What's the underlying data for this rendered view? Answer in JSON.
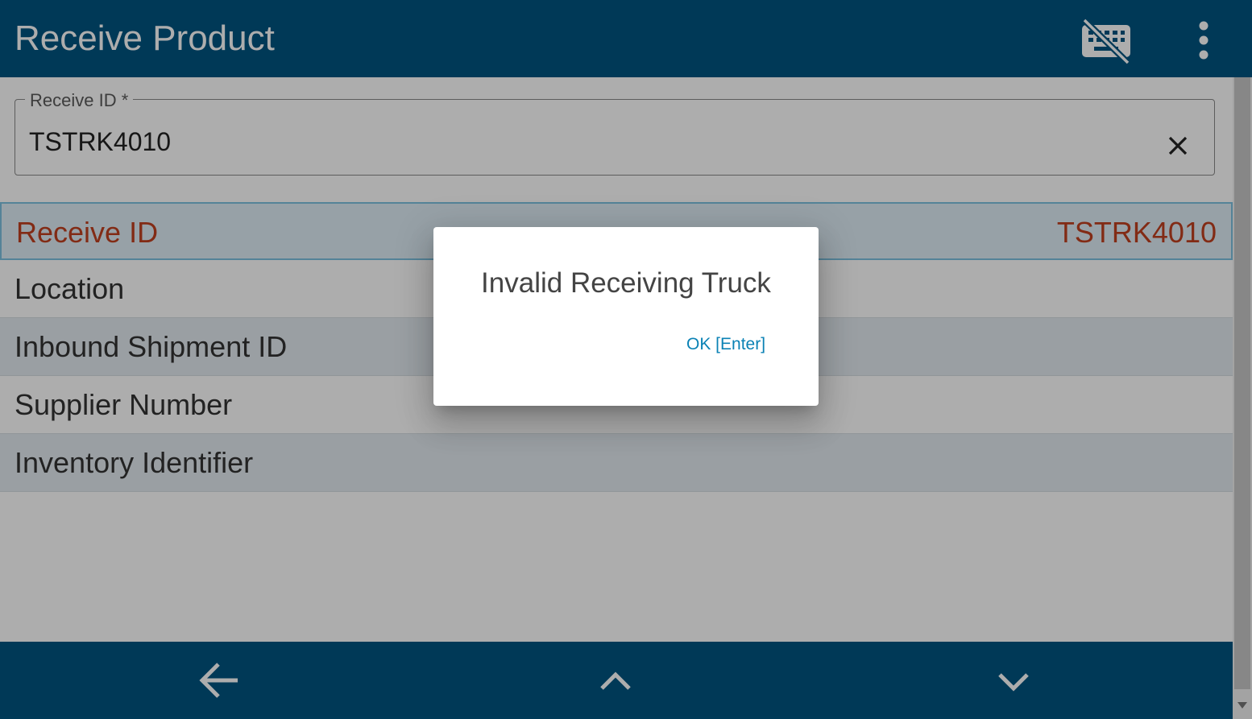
{
  "app_bar": {
    "title": "Receive Product",
    "keyboard_icon": "keyboard-off-icon",
    "menu_icon": "more-vert-icon"
  },
  "form": {
    "label": "Receive ID *",
    "value": "TSTRK4010",
    "clear_icon": "close-icon"
  },
  "details": [
    {
      "label": "Receive ID",
      "value": "TSTRK4010"
    },
    {
      "label": "Location",
      "value": ""
    },
    {
      "label": "Inbound Shipment ID",
      "value": ""
    },
    {
      "label": "Supplier Number",
      "value": ""
    },
    {
      "label": "Inventory Identifier",
      "value": ""
    }
  ],
  "bottom_nav": {
    "back_icon": "arrow-left-icon",
    "up_icon": "chevron-up-icon",
    "down_icon": "chevron-down-icon"
  },
  "dialog": {
    "message": "Invalid Receiving Truck",
    "ok_label": "OK [Enter]"
  },
  "colors": {
    "primary": "#005581",
    "highlight_text": "#c0401f",
    "link": "#0b82b5"
  }
}
